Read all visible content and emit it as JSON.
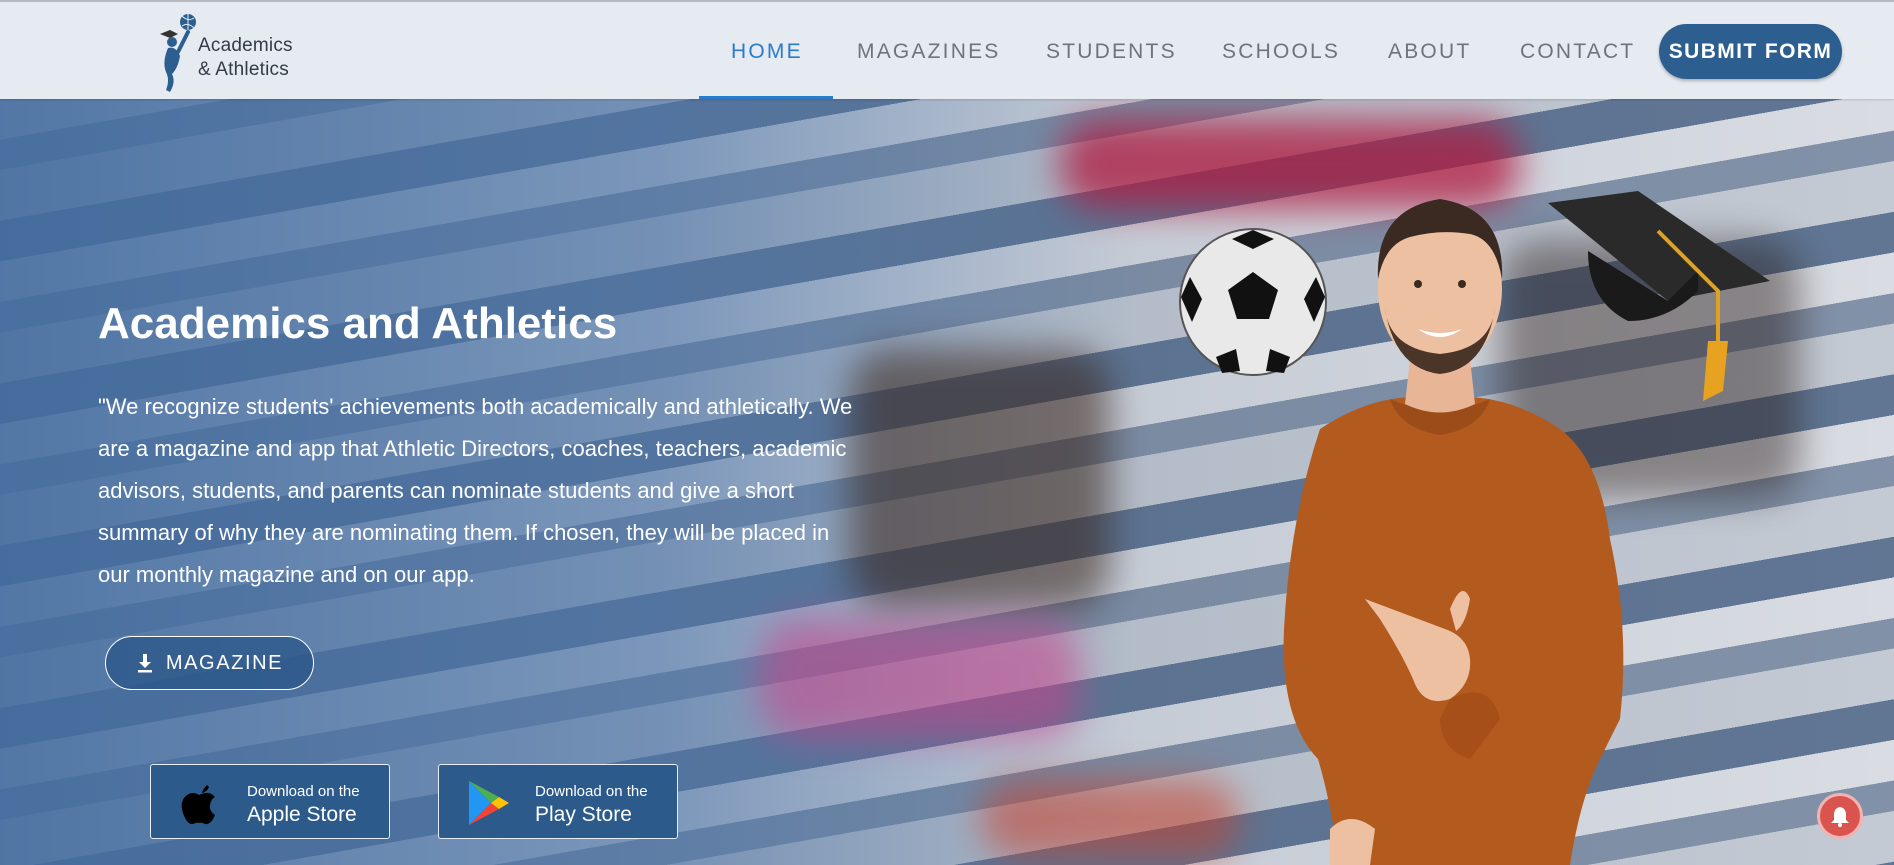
{
  "brand": {
    "line1": "Academics",
    "line2": "& Athletics"
  },
  "nav": {
    "items": [
      {
        "label": "HOME"
      },
      {
        "label": "MAGAZINES"
      },
      {
        "label": "STUDENTS"
      },
      {
        "label": "SCHOOLS"
      },
      {
        "label": "ABOUT"
      },
      {
        "label": "CONTACT"
      }
    ],
    "active": "HOME",
    "submit_label": "SUBMIT FORM"
  },
  "hero": {
    "title": "Academics and Athletics",
    "text": "\"We recognize students' achievements both academically and athletically. We are a magazine and app that Athletic Directors, coaches, teachers, academic advisors, students, and parents can nominate students and give a short summary of why they are nominating them. If chosen, they will be placed in our monthly magazine and on our app.",
    "magazine_label": "MAGAZINE"
  },
  "apps": {
    "apple": {
      "small": "Download on the",
      "big": "Apple Store"
    },
    "play": {
      "small": "Download on the",
      "big": "Play Store"
    }
  },
  "colors": {
    "accent": "#2a7ccb",
    "button": "#2c5f90",
    "header_bg": "#e6ebf2",
    "bell": "#d9534f"
  },
  "icons": [
    "logo-icon",
    "download-icon",
    "apple-icon",
    "play-store-icon",
    "bell-icon",
    "soccer-ball-icon",
    "graduation-cap-icon"
  ]
}
